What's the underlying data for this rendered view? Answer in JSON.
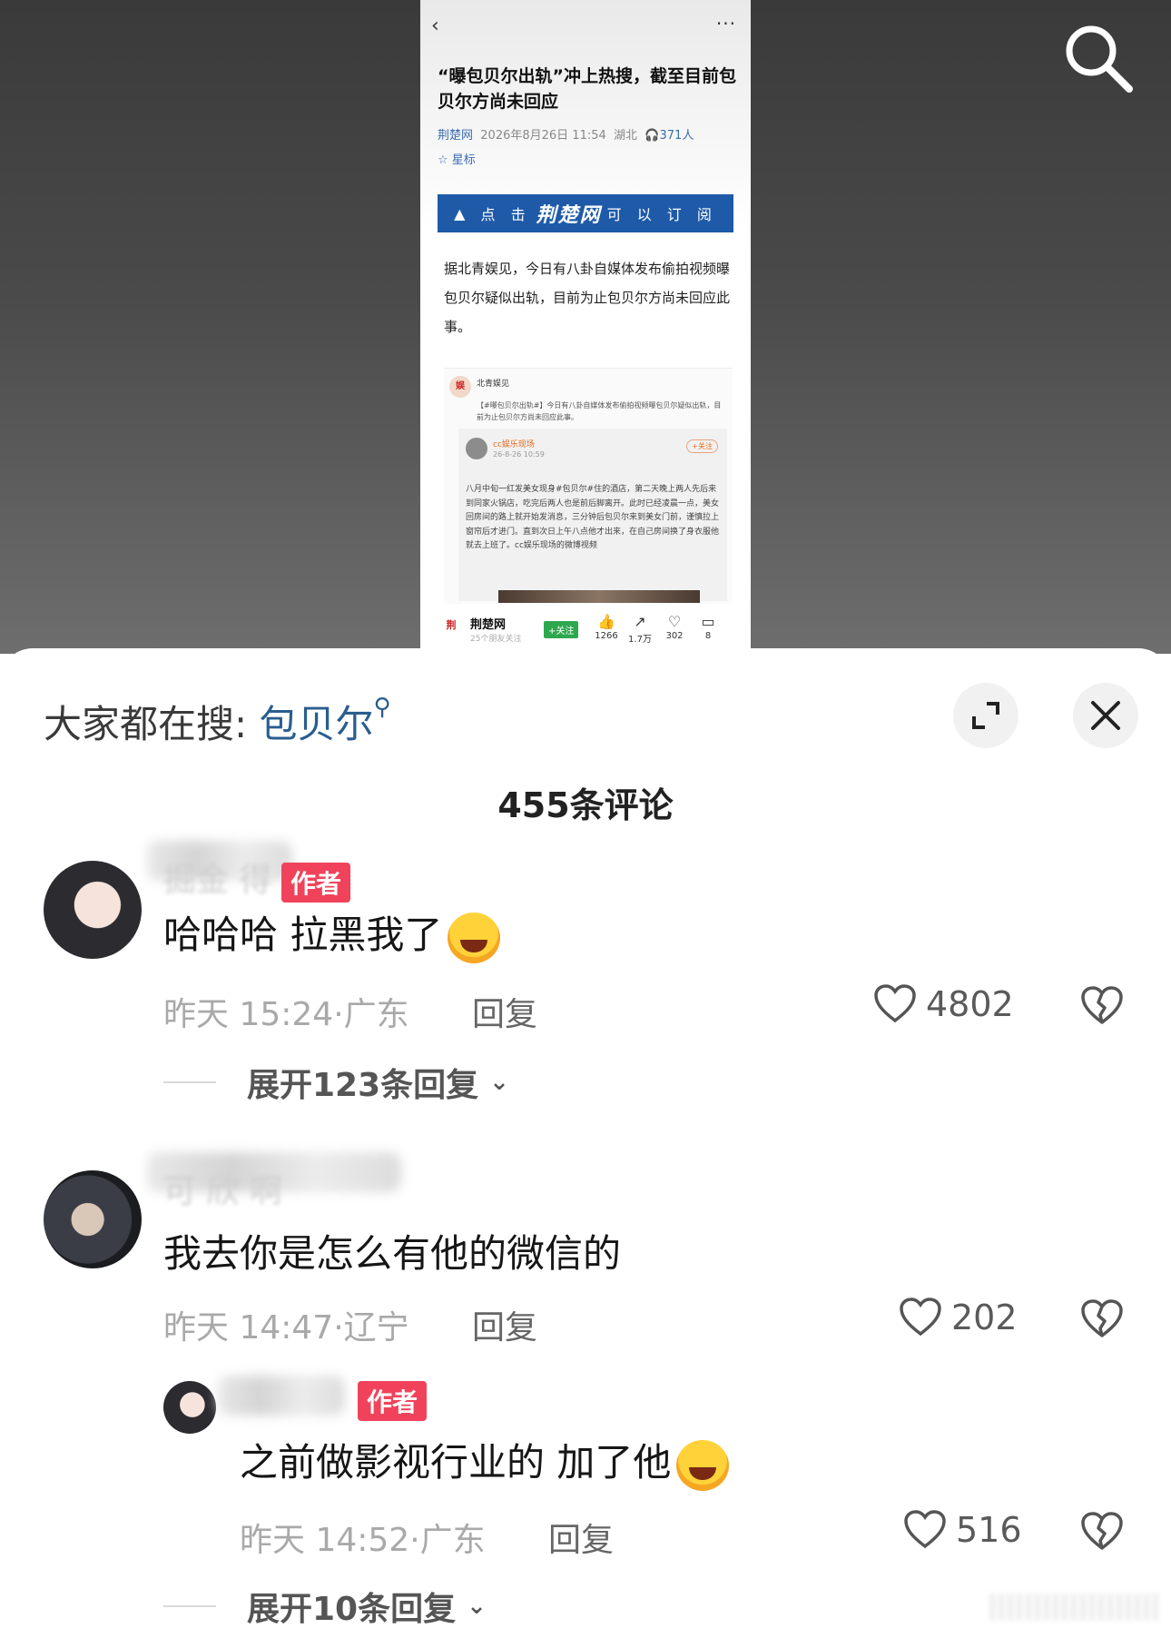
{
  "article": {
    "back_icon": "‹",
    "more_icon": "···",
    "title": "“曝包贝尔出轨”冲上热搜，截至目前包贝尔方尚未回应",
    "source": "荆楚网",
    "datetime": "2026年8月26日 11:54",
    "region": "湖北",
    "listeners": "371人",
    "star_label": "☆ 星标",
    "banner_left": "点 击",
    "banner_logo": "荆楚网",
    "banner_right": "可 以 订 阅",
    "body": "据北青娱见，今日有八卦自媒体发布偷拍视频曝包贝尔疑似出轨，目前为止包贝尔方尚未回应此事。",
    "embed": {
      "account": "北青娱见",
      "text": "【#曝包贝尔出轨#】今日有八卦自媒体发布偷拍视频曝包贝尔疑似出轨，目前为止包贝尔方尚未回应此事。",
      "quote_account": "cc娱乐现场",
      "quote_follow": "+关注",
      "quote_time": "26-8-26 10:59",
      "quote_text": "八月中旬一红发美女现身#包贝尔#住的酒店，第二天晚上两人先后来到同家火锅店，吃完后两人也是前后脚离开。此时已经凌晨一点，美女回房间的路上就开始发消息，三分钟后包贝尔来到美女门前，谨慎拉上窗帘后才进门。直到次日上午八点他才出来，在自己房间换了身衣服他就去上班了。cc娱乐现场的微博视频"
    },
    "bottom": {
      "name": "荆楚网",
      "sub": "25个朋友关注",
      "follow": "+关注",
      "likes": "1266",
      "shares": "1.7万",
      "favs": "302",
      "comments": "8"
    }
  },
  "sheet": {
    "hot_prefix": "大家都在搜:",
    "hot_keyword": "包贝尔",
    "comment_count": "455条评论"
  },
  "comments": [
    {
      "username": "掘金 得",
      "author_tag": "作者",
      "text": "哈哈哈 拉黑我了",
      "time": "昨天 15:24",
      "location": "广东",
      "reply": "回复",
      "likes": "4802",
      "expand": "展开123条回复"
    },
    {
      "username": "可 欣 啊",
      "text": "我去你是怎么有他的微信的",
      "time": "昨天 14:47",
      "location": "辽宁",
      "reply": "回复",
      "likes": "202"
    },
    {
      "author_tag": "作者",
      "text": "之前做影视行业的 加了他",
      "time": "昨天 14:52",
      "location": "广东",
      "reply": "回复",
      "likes": "516",
      "expand": "展开10条回复"
    }
  ],
  "icons": {
    "search": "search-icon",
    "expand": "expand-icon",
    "close": "close-icon",
    "heart": "heart-icon",
    "broken_heart": "broken-heart-icon"
  },
  "colors": {
    "author_tag": "#f0435b",
    "keyword": "#2a5d8f",
    "banner": "#1e5aa8"
  }
}
